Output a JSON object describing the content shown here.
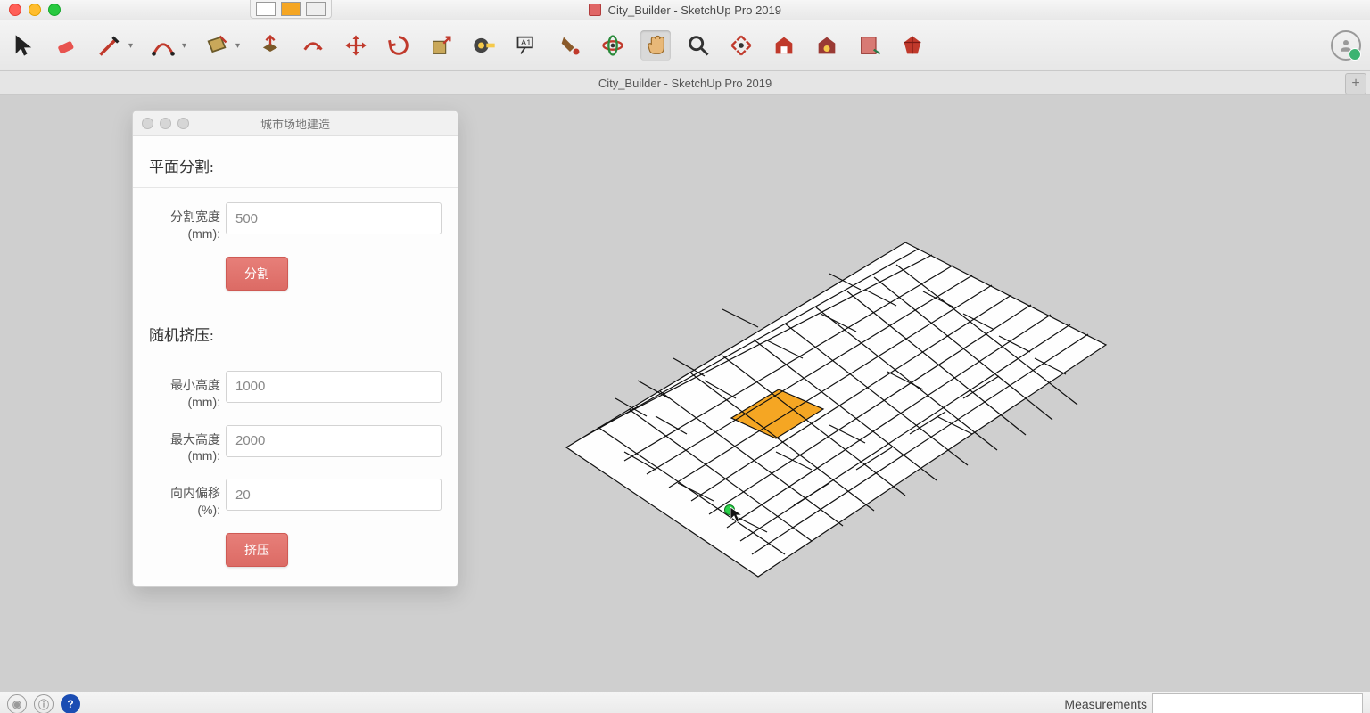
{
  "app": {
    "title": "City_Builder - SketchUp Pro 2019",
    "tab_title": "City_Builder - SketchUp Pro 2019"
  },
  "dialog": {
    "title": "城市场地建造",
    "section1": {
      "heading": "平面分割:",
      "split_width_label": "分割宽度 (mm):",
      "split_width_value": "500",
      "split_button": "分割"
    },
    "section2": {
      "heading": "随机挤压:",
      "min_height_label": "最小高度 (mm):",
      "min_height_value": "1000",
      "max_height_label": "最大高度 (mm):",
      "max_height_value": "2000",
      "inset_label": "向内偏移 (%):",
      "inset_value": "20",
      "extrude_button": "挤压"
    }
  },
  "statusbar": {
    "measurements_label": "Measurements",
    "measurements_value": ""
  },
  "colors": {
    "accent_button": "#e2736d",
    "selected_face": "#f5a623"
  }
}
